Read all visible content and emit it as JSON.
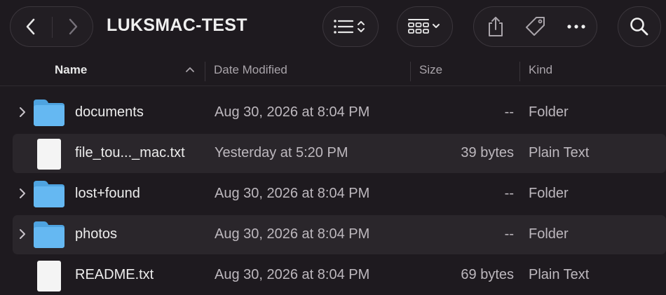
{
  "window": {
    "title": "LUKSMAC-TEST"
  },
  "toolbar": {
    "back_icon": "chevron-left-icon",
    "forward_icon": "chevron-right-icon",
    "view_options_icon": "list-view-icon",
    "group_icon": "grid-group-icon",
    "share_icon": "share-icon",
    "tag_icon": "tag-icon",
    "more_icon": "ellipsis-icon",
    "search_icon": "search-icon"
  },
  "columns": {
    "name": "Name",
    "date": "Date Modified",
    "size": "Size",
    "kind": "Kind"
  },
  "files": [
    {
      "name": "documents",
      "date": "Aug 30, 2026 at 8:04 PM",
      "size": "--",
      "kind": "Folder",
      "type": "folder"
    },
    {
      "name": "file_tou..._mac.txt",
      "date": "Yesterday at 5:20 PM",
      "size": "39 bytes",
      "kind": "Plain Text",
      "type": "file"
    },
    {
      "name": "lost+found",
      "date": "Aug 30, 2026 at 8:04 PM",
      "size": "--",
      "kind": "Folder",
      "type": "folder"
    },
    {
      "name": "photos",
      "date": "Aug 30, 2026 at 8:04 PM",
      "size": "--",
      "kind": "Folder",
      "type": "folder"
    },
    {
      "name": "README.txt",
      "date": "Aug 30, 2026 at 8:04 PM",
      "size": "69 bytes",
      "kind": "Plain Text",
      "type": "file"
    }
  ],
  "colors": {
    "background": "#1e1a1f",
    "row_alt": "#2a262b",
    "folder_blue": "#5fb4f0",
    "document_white": "#f4f4f4"
  }
}
